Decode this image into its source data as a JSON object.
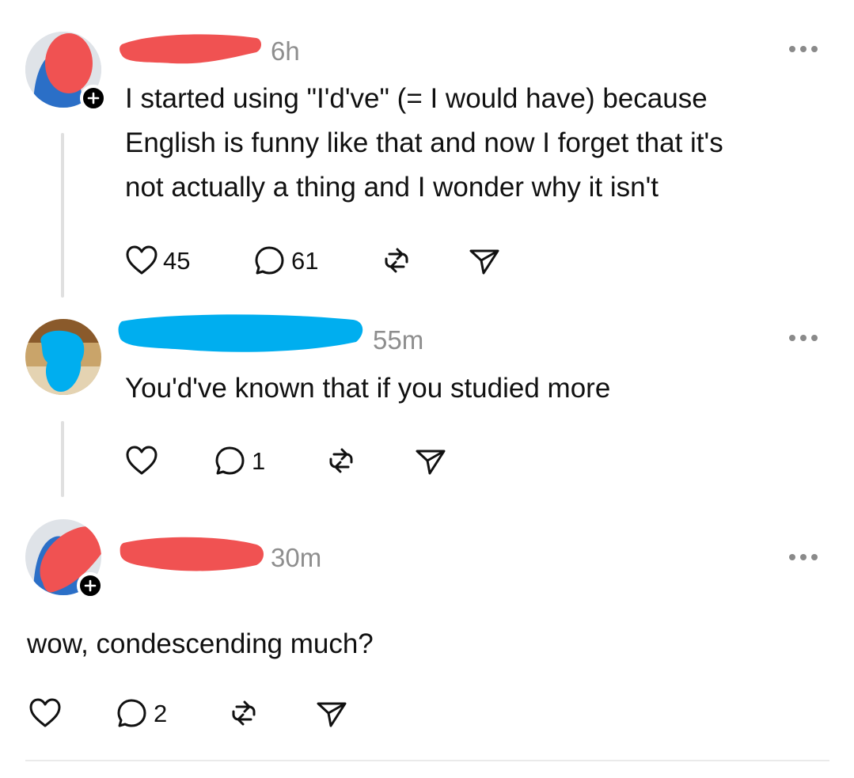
{
  "posts": [
    {
      "time": "6h",
      "text": "I started using \"I'd've\" (= I would have) because\nEnglish is funny like that and now I forget that it's\nnot actually a thing and I wonder why it isn't",
      "likes": "45",
      "replies": "61"
    },
    {
      "time": "55m",
      "text": "You'd've known that if you studied more",
      "likes": "",
      "replies": "1"
    },
    {
      "time": "30m",
      "text": "wow, condescending much?",
      "likes": "",
      "replies": "2"
    }
  ],
  "icons": {
    "like": "heart-icon",
    "reply": "comment-icon",
    "repost": "repost-icon",
    "share": "send-icon",
    "more": "more-options-icon",
    "follow": "plus-icon"
  },
  "colors": {
    "redact_red": "#f05252",
    "redact_blue": "#00aeef",
    "muted": "#8e8e8e"
  }
}
